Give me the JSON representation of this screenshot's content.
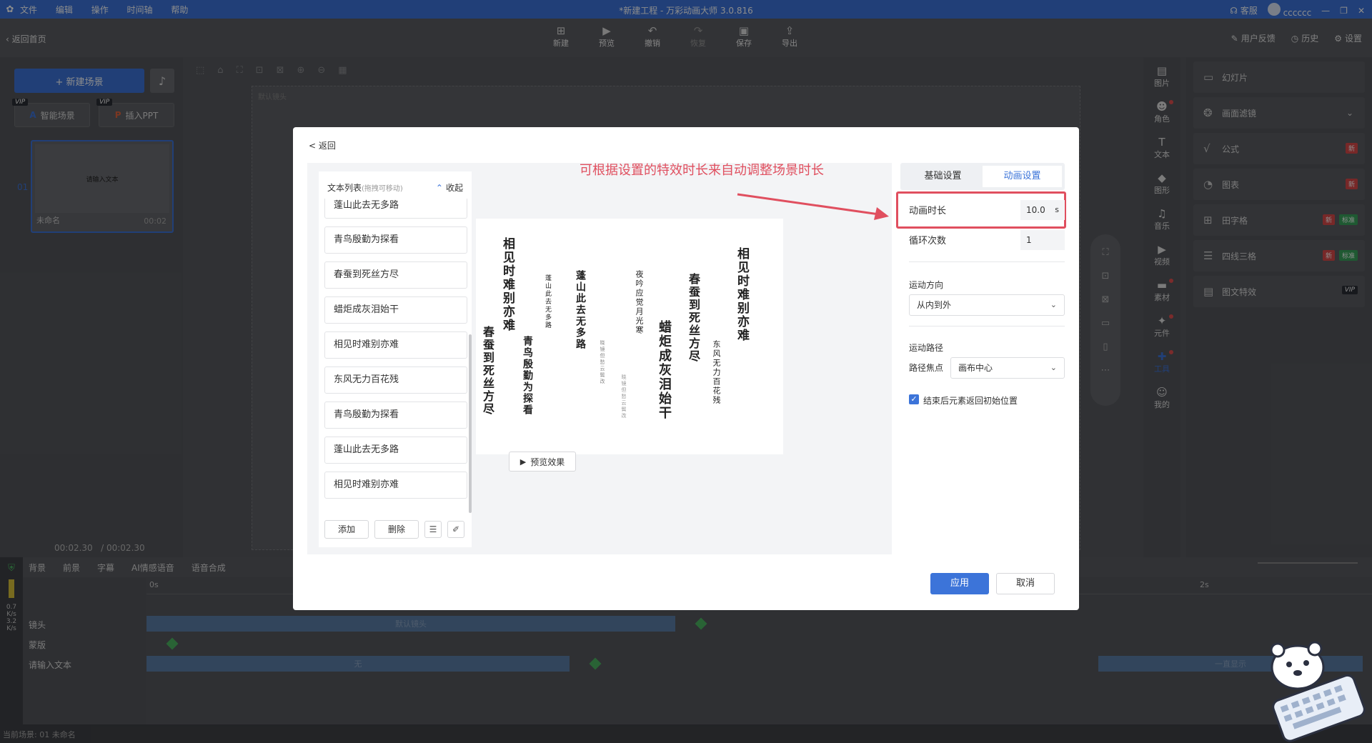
{
  "window": {
    "title": "*新建工程 - 万彩动画大师 3.0.816",
    "menu": [
      "文件",
      "编辑",
      "操作",
      "时间轴",
      "帮助"
    ],
    "service": "客服",
    "user": "cccccc"
  },
  "toolbar": {
    "back_home": "返回首页",
    "tools": [
      {
        "icon": "plus-icon",
        "label": "新建"
      },
      {
        "icon": "play-icon",
        "label": "预览"
      },
      {
        "icon": "undo-icon",
        "label": "撤销"
      },
      {
        "icon": "redo-icon",
        "label": "恢复"
      },
      {
        "icon": "save-icon",
        "label": "保存"
      },
      {
        "icon": "export-icon",
        "label": "导出"
      }
    ],
    "right": [
      "用户反馈",
      "历史",
      "设置"
    ]
  },
  "scenes": {
    "new_scene": "+ 新建场景",
    "smart_scene": "智能场景",
    "insert_ppt": "插入PPT",
    "vip": "VIP",
    "items": [
      {
        "num": "01",
        "content": "请输入文本",
        "name": "未命名",
        "duration": "00:02"
      }
    ],
    "time_current": "00:02.30",
    "time_total": "/ 00:02.30"
  },
  "stage": {
    "label": "默认镜头"
  },
  "right_sidebar": [
    "图片",
    "角色",
    "文本",
    "图形",
    "音乐",
    "视频",
    "素材",
    "元件",
    "工具",
    "我的"
  ],
  "right_panel": [
    {
      "label": "幻灯片",
      "tags": []
    },
    {
      "label": "画面滤镜",
      "tags": []
    },
    {
      "label": "公式",
      "tags": [
        "新"
      ]
    },
    {
      "label": "图表",
      "tags": [
        "新"
      ]
    },
    {
      "label": "田字格",
      "tags": [
        "新",
        "标准"
      ]
    },
    {
      "label": "四线三格",
      "tags": [
        "新",
        "标准"
      ]
    },
    {
      "label": "图文特效",
      "tags": [
        "VIP"
      ]
    }
  ],
  "timeline": {
    "tabs": [
      "背景",
      "前景",
      "字幕",
      "AI情感语音",
      "语音合成"
    ],
    "tracks": [
      "镜头",
      "蒙版",
      "请输入文本"
    ],
    "clips": {
      "camera": "默认镜头",
      "text": "无",
      "text_end": "一直显示"
    },
    "ruler_start": "0s",
    "ruler_2s": "2s",
    "speed_up": "0.7",
    "speed_unit": "K/s",
    "speed_down": "3.2",
    "status": "当前场景: 01   未命名"
  },
  "modal": {
    "back": "< 返回",
    "annotation": "可根据设置的特效时长来自动调整场景时长",
    "list_title": "文本列表",
    "list_hint": "(拖拽可移动)",
    "collapse": "收起",
    "items": [
      "蓬山此去无多路",
      "青鸟殷勤为探看",
      "春蚕到死丝方尽",
      "蜡炬成灰泪始干",
      "相见时难别亦难",
      "东风无力百花残",
      "青鸟殷勤为探看",
      "蓬山此去无多路",
      "相见时难别亦难"
    ],
    "add": "添加",
    "delete": "删除",
    "preview_button": "预览效果",
    "preview_columns": [
      "春蚕到死丝方尽",
      "相见时难别亦难",
      "青鸟殷勤为探看",
      "蓬山此去无多路",
      "蓬山此去无多路",
      "夜吟应觉月光寒",
      "晓镜但愁云鬓改",
      "蜡炬成灰泪始干",
      "春蚕到死丝方尽",
      "东风无力百花残",
      "相见时难别亦难",
      "晓镜但愁云鬓改"
    ],
    "tabs": [
      "基础设置",
      "动画设置"
    ],
    "active_tab": "动画设置",
    "duration_label": "动画时长",
    "duration_value": "10.0",
    "duration_unit": "s",
    "loop_label": "循环次数",
    "loop_value": "1",
    "direction_label": "运动方向",
    "direction_value": "从内到外",
    "path_label": "运动路径",
    "focus_label": "路径焦点",
    "focus_value": "画布中心",
    "return_label": "结束后元素返回初始位置",
    "return_checked": true,
    "apply": "应用",
    "cancel": "取消"
  },
  "colors": {
    "accent": "#3c74d9",
    "annotation": "#e04f5f",
    "keyframe": "#4bb562"
  }
}
